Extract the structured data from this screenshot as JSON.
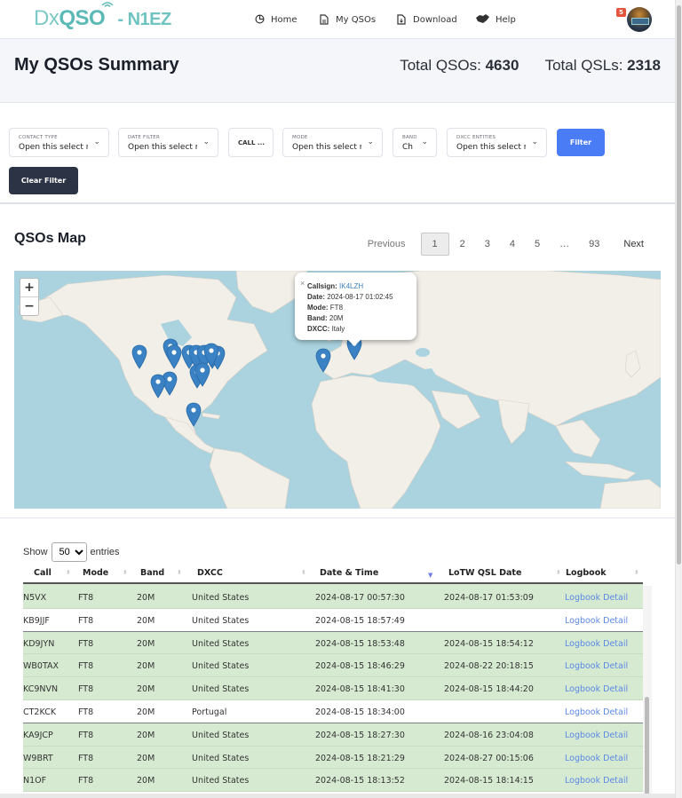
{
  "header": {
    "logo_dx": "Dx",
    "logo_qso": "QSO",
    "logo_call": "- N1EZ",
    "nav": [
      {
        "label": "Home",
        "icon": "pie-chart-icon"
      },
      {
        "label": "My QSOs",
        "icon": "document-icon"
      },
      {
        "label": "Download",
        "icon": "download-document-icon"
      },
      {
        "label": "Help",
        "icon": "handshake-icon"
      }
    ],
    "notification_count": "5"
  },
  "summary": {
    "title": "My QSOs Summary",
    "total_qsos_label": "Total QSOs:",
    "total_qsos": "4630",
    "total_qsls_label": "Total QSLs:",
    "total_qsls": "2318"
  },
  "filters": {
    "contact_type": {
      "label": "CONTACT TYPE",
      "value": "Open this select m"
    },
    "date_filter": {
      "label": "DATE FILTER",
      "value": "Open this select m"
    },
    "call": {
      "placeholder": "CALL ..."
    },
    "mode": {
      "label": "MODE",
      "value": "Open this select m"
    },
    "band": {
      "label": "BAND",
      "value": "Ch"
    },
    "dxcc": {
      "label": "DXCC ENTITIES",
      "value": "Open this select m"
    },
    "filter_button": "Filter",
    "clear_button": "Clear Filter"
  },
  "map_section": {
    "title": "QSOs Map",
    "pagination": {
      "previous": "Previous",
      "pages": [
        "1",
        "2",
        "3",
        "4",
        "5",
        "…",
        "93"
      ],
      "active": "1",
      "next": "Next"
    },
    "zoom_in": "+",
    "zoom_out": "−",
    "popup": {
      "close": "×",
      "callsign_label": "Callsign:",
      "callsign": "IK4LZH",
      "date_label": "Date:",
      "date": "2024-08-17 01:02:45",
      "mode_label": "Mode:",
      "mode": "FT8",
      "band_label": "Band:",
      "band": "20M",
      "dxcc_label": "DXCC:",
      "dxcc": "Italy"
    },
    "marker_color": "#3a82c4"
  },
  "table": {
    "show_label": "Show",
    "entries_value": "50",
    "entries_label": "entries",
    "columns": [
      "Call",
      "Mode",
      "Band",
      "DXCC",
      "Date & Time",
      "LoTW QSL Date",
      "Logbook"
    ],
    "sorted_column": "Date & Time",
    "rows": [
      {
        "call": "N5VX",
        "mode": "FT8",
        "band": "20M",
        "dxcc": "United States",
        "datetime": "2024-08-17 00:57:30",
        "lotw": "2024-08-17 01:53:09",
        "logbook": "Logbook Detail",
        "confirmed": true
      },
      {
        "call": "KB9JJF",
        "mode": "FT8",
        "band": "20M",
        "dxcc": "United States",
        "datetime": "2024-08-15 18:57:49",
        "lotw": "",
        "logbook": "Logbook Detail",
        "confirmed": false
      },
      {
        "call": "KD9JYN",
        "mode": "FT8",
        "band": "20M",
        "dxcc": "United States",
        "datetime": "2024-08-15 18:53:48",
        "lotw": "2024-08-15 18:54:12",
        "logbook": "Logbook Detail",
        "confirmed": true
      },
      {
        "call": "WB0TAX",
        "mode": "FT8",
        "band": "20M",
        "dxcc": "United States",
        "datetime": "2024-08-15 18:46:29",
        "lotw": "2024-08-22 20:18:15",
        "logbook": "Logbook Detail",
        "confirmed": true
      },
      {
        "call": "KC9NVN",
        "mode": "FT8",
        "band": "20M",
        "dxcc": "United States",
        "datetime": "2024-08-15 18:41:30",
        "lotw": "2024-08-15 18:44:20",
        "logbook": "Logbook Detail",
        "confirmed": true
      },
      {
        "call": "CT2KCK",
        "mode": "FT8",
        "band": "20M",
        "dxcc": "Portugal",
        "datetime": "2024-08-15 18:34:00",
        "lotw": "",
        "logbook": "Logbook Detail",
        "confirmed": false
      },
      {
        "call": "KA9JCP",
        "mode": "FT8",
        "band": "20M",
        "dxcc": "United States",
        "datetime": "2024-08-15 18:27:30",
        "lotw": "2024-08-16 23:04:08",
        "logbook": "Logbook Detail",
        "confirmed": true
      },
      {
        "call": "W9BRT",
        "mode": "FT8",
        "band": "20M",
        "dxcc": "United States",
        "datetime": "2024-08-15 18:21:29",
        "lotw": "2024-08-27 00:15:06",
        "logbook": "Logbook Detail",
        "confirmed": true
      },
      {
        "call": "N1OF",
        "mode": "FT8",
        "band": "20M",
        "dxcc": "United States",
        "datetime": "2024-08-15 18:13:52",
        "lotw": "2024-08-15 18:14:15",
        "logbook": "Logbook Detail",
        "confirmed": true
      }
    ],
    "confirmed_row_color": "#d6ead1",
    "link_color": "#5b88e6"
  },
  "colors": {
    "brand": "#5bbab6",
    "filter_button": "#4a7cf6",
    "clear_button": "#2c3344",
    "badge": "#e4543c"
  }
}
